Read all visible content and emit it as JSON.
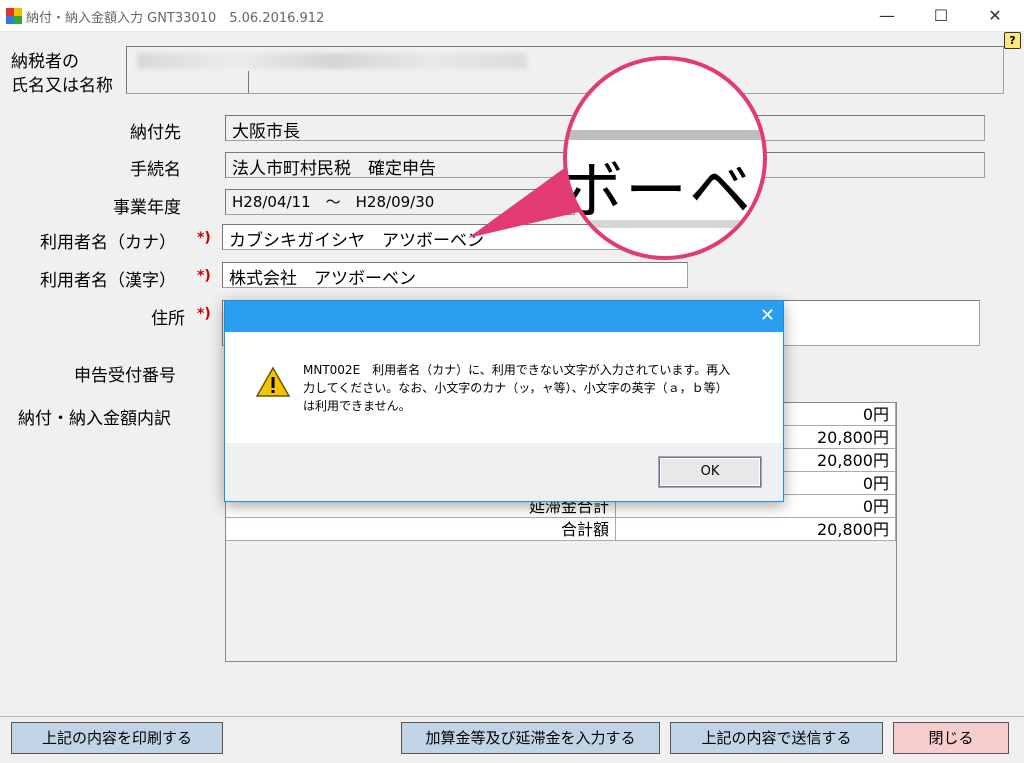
{
  "window": {
    "title": "納付・納入金額入力 GNT33010　5.06.2016.912",
    "minimize_glyph": "—",
    "maximize_glyph": "☐",
    "close_glyph": "✕",
    "help_glyph": "?"
  },
  "form": {
    "taxpayer_label_line1": "納税者の",
    "taxpayer_label_line2": "氏名又は名称",
    "payee_label": "納付先",
    "payee_value": "大阪市長",
    "procedure_label": "手続名",
    "procedure_value": "法人市町村民税　確定申告",
    "fiscal_year_label": "事業年度",
    "fiscal_year_value": "H28/04/11　～　H28/09/30",
    "user_kana_label": "利用者名（カナ）",
    "user_kana_value": "カブシキガイシヤ　アツボーベン",
    "user_kanji_label": "利用者名（漢字）",
    "user_kanji_value": "株式会社　アツボーベン",
    "address_label": "住所",
    "receipt_label": "申告受付番号",
    "breakdown_label": "納付・納入金額内訳",
    "required_mark": "*)"
  },
  "amounts": {
    "rows": [
      {
        "label": "",
        "value": "0円"
      },
      {
        "label": "",
        "value": "20,800円"
      },
      {
        "label": "",
        "value": "20,800円"
      },
      {
        "label": "",
        "value": "0円"
      },
      {
        "label": "延滞金合計",
        "value": "0円"
      },
      {
        "label": "合計額",
        "value": "20,800円"
      }
    ]
  },
  "dialog": {
    "close_glyph": "✕",
    "message_line1": "MNT002E　利用者名（カナ）に、利用できない文字が入力されています。再入",
    "message_line2": "力してください。なお、小文字のカナ（ッ，ャ等）、小文字の英字（ａ，ｂ等）",
    "message_line3": "は利用できません。",
    "ok_label": "OK",
    "icon": "warning-icon"
  },
  "magnifier": {
    "text": "ボーベ"
  },
  "buttons": {
    "print": "上記の内容を印刷する",
    "additional": "加算金等及び延滞金を入力する",
    "send": "上記の内容で送信する",
    "close": "閉じる"
  },
  "colors": {
    "dialog_title": "#2b9ef0",
    "magnifier_ring": "#e23a73",
    "required": "#d00000",
    "action_button": "#c0d4e6",
    "close_button": "#f6cccc"
  }
}
